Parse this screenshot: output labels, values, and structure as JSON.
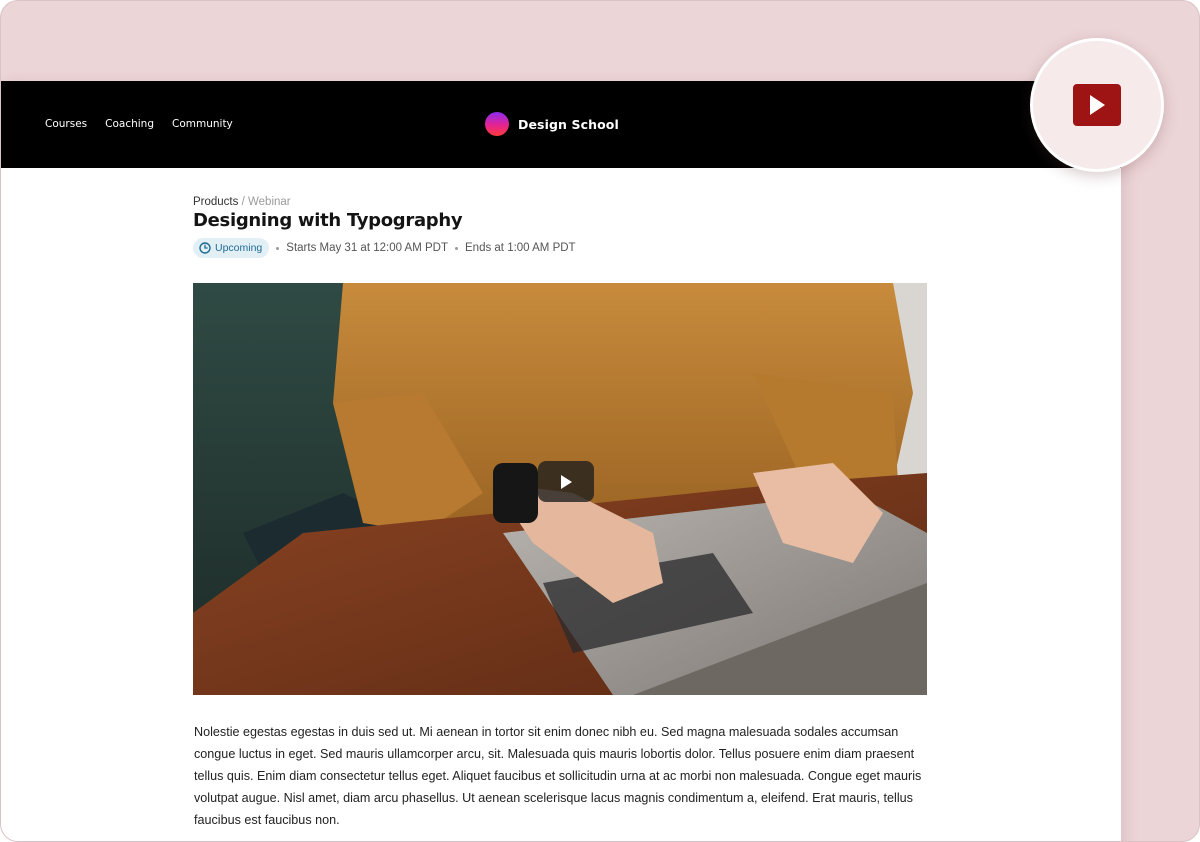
{
  "nav": {
    "links": [
      "Courses",
      "Coaching",
      "Community"
    ],
    "brand_name": "Design School"
  },
  "breadcrumb": {
    "parent": "Products",
    "separator": "/",
    "current": "Webinar"
  },
  "event": {
    "title": "Designing with Typography",
    "status": "Upcoming",
    "starts": "Starts May 31 at 12:00 AM PDT",
    "ends": "Ends at 1:00 AM PDT"
  },
  "video": {
    "alt": "Person in a mustard sweater typing on a laptop"
  },
  "description": "Nolestie egestas egestas in duis sed ut. Mi aenean in tortor sit enim donec nibh eu. Sed magna malesuada sodales accumsan congue luctus in eget. Sed mauris ullamcorper arcu, sit. Malesuada quis mauris lobortis dolor. Tellus posuere enim diam praesent tellus quis. Enim diam consectetur tellus eget. Aliquet faucibus et sollicitudin urna at ac morbi non malesuada. Congue eget mauris volutpat augue. Nisl amet, diam arcu phasellus. Ut aenean scelerisque lacus magnis condimentum a, eleifend. Erat mauris, tellus faucibus est faucibus non.",
  "colors": {
    "background": "#ecd5d7",
    "navbar": "#000000",
    "badge_bg": "#e2f0f6",
    "badge_text": "#1f6b94",
    "youtube_red": "#9e1414"
  },
  "icons": {
    "status": "clock-icon",
    "video_play": "play-icon",
    "youtube": "youtube-play-icon"
  }
}
